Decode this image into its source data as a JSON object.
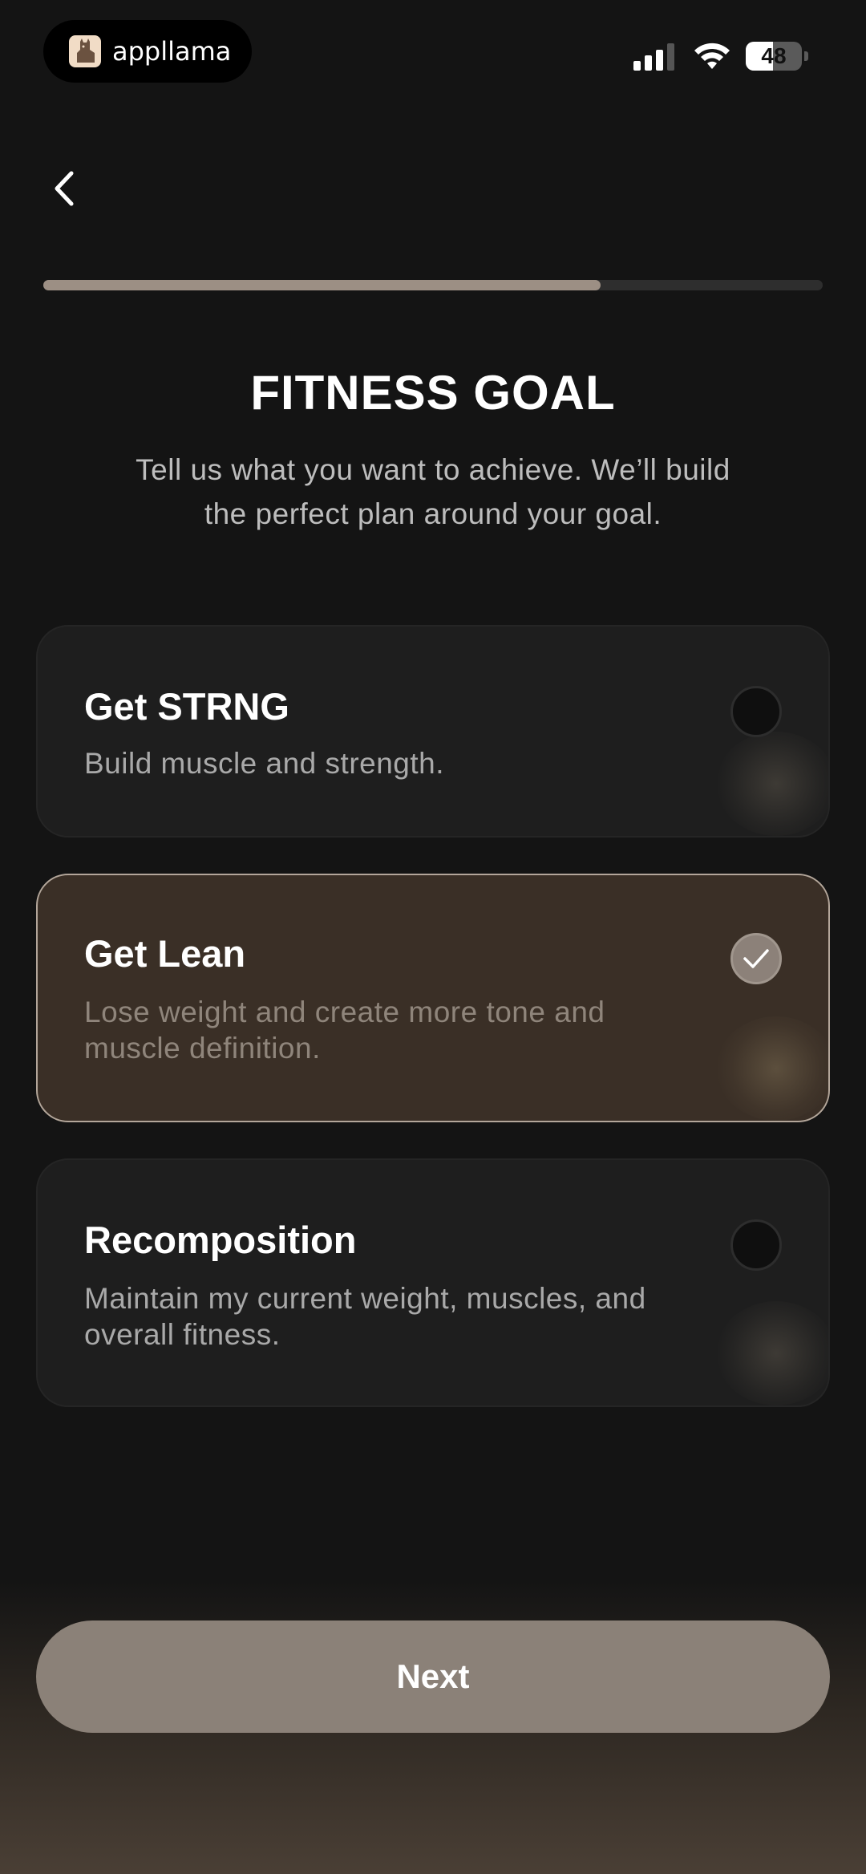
{
  "status_bar": {
    "brand_name": "appllama",
    "brand_icon": "llama-icon",
    "battery_level": 48,
    "battery_label": "48",
    "signal_icon": "cellular-signal-icon",
    "wifi_icon": "wifi-icon"
  },
  "nav": {
    "back_icon": "chevron-left-icon"
  },
  "progress": {
    "fraction": 0.715
  },
  "header": {
    "title": "FITNESS GOAL",
    "subtitle": "Tell us what you want to achieve. We’ll build the perfect plan around your goal."
  },
  "options": [
    {
      "title": "Get STRNG",
      "description": "Build muscle and strength.",
      "selected": false
    },
    {
      "title": "Get Lean",
      "description": "Lose weight and create more tone and muscle definition.",
      "selected": true
    },
    {
      "title": "Recomposition",
      "description": "Maintain my current weight, muscles, and overall fitness.",
      "selected": false
    }
  ],
  "footer": {
    "next_label": "Next"
  },
  "colors": {
    "background": "#141414",
    "card": "#1e1e1e",
    "card_selected": "#3a2f26",
    "accent": "#8b8178",
    "progress_fill": "#9c8f84"
  }
}
